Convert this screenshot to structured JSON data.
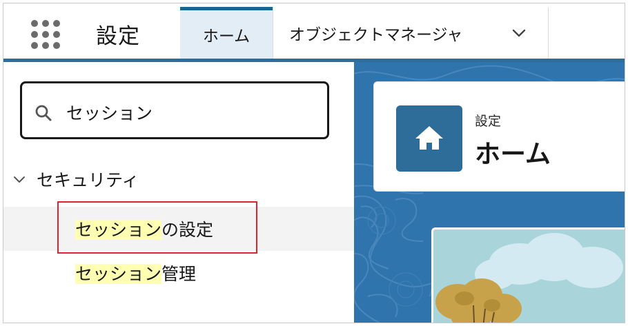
{
  "header": {
    "app_title": "設定",
    "tabs": [
      {
        "label": "ホーム",
        "active": true
      },
      {
        "label": "オブジェクトマネージャ",
        "active": false
      }
    ],
    "accent_color": "#2e6c99"
  },
  "sidebar": {
    "search": {
      "value": "セッション"
    },
    "sections": [
      {
        "label": "セキュリティ",
        "expanded": true,
        "items": [
          {
            "highlight": "セッション",
            "rest": "の設定",
            "selected": true
          },
          {
            "highlight": "セッション",
            "rest": "管理",
            "selected": false
          }
        ]
      }
    ]
  },
  "main": {
    "card": {
      "subtitle": "設定",
      "title": "ホーム"
    }
  },
  "icons": [
    "app-launcher-icon",
    "chevron-down-icon",
    "search-icon",
    "home-icon"
  ]
}
